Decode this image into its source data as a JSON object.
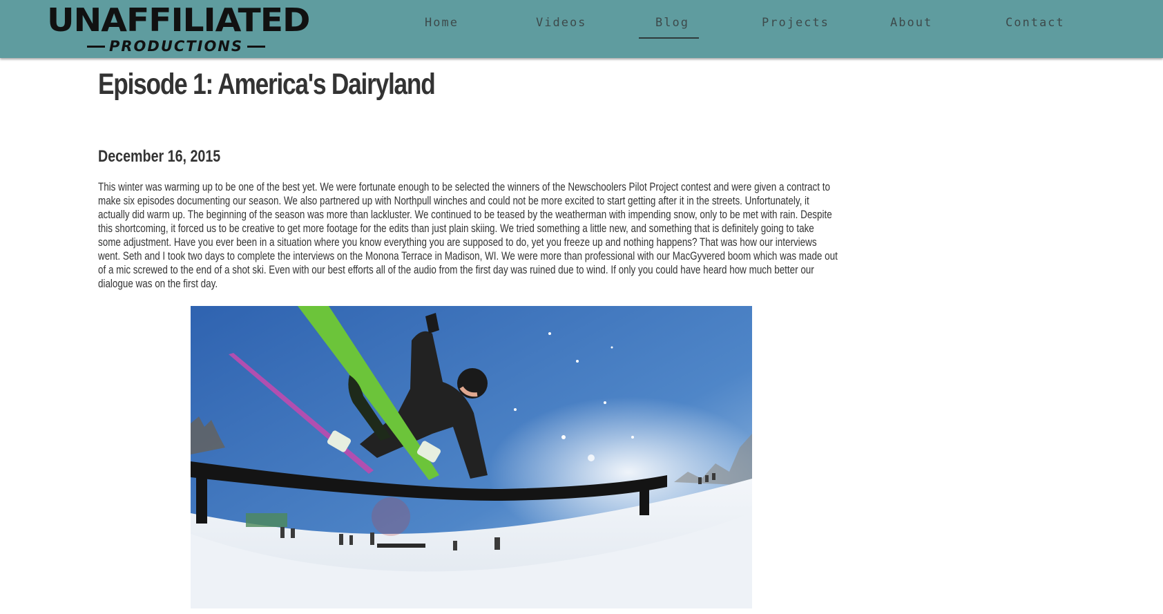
{
  "brand": {
    "logo_top": "UNAFFILIATED",
    "logo_bottom": "PRODUCTIONS"
  },
  "nav": {
    "items": [
      {
        "label": "Home",
        "active": false
      },
      {
        "label": "Videos",
        "active": false
      },
      {
        "label": "Blog",
        "active": true
      },
      {
        "label": "Projects",
        "active": false
      },
      {
        "label": "About",
        "active": false
      },
      {
        "label": "Contact",
        "active": false
      }
    ]
  },
  "post": {
    "title": "Episode 1: America's Dairyland",
    "date": "December 16, 2015",
    "body": "This winter was warming up to be one of the best yet. We were fortunate enough to be selected the winners of the Newschoolers Pilot Project contest and were given a contract to make six episodes documenting our season. We also partnered up with Northpull winches and could not be more excited to start getting after it in the streets. Unfortunately, it actually did warm up. The beginning of the season was more than lackluster. We continued to be teased by the weatherman with impending snow, only to be met with rain. Despite this shortcoming, it forced us to be creative to get more footage for the edits than just plain skiing. We tried something a little new, and something that is definitely going to take some adjustment. Have you ever been in a situation where you know everything you are supposed to do, yet you freeze up and nothing happens? That was how our interviews went. Seth and I took two days to complete the interviews on the Monona Terrace in Madison, WI. We were more than professional with our MacGyvered boom which was made out of a mic screwed to the end of a shot ski. Even with our best efforts all of the audio from the first day was ruined due to wind. If only you could have heard how much better our dialogue was on the first day."
  },
  "colors": {
    "header_bg": "#5f9c9f",
    "nav_text": "#3d4a4b",
    "heading_text": "#333333",
    "ski_top_sheet": "#6cc43a",
    "sky": "#3f72b8"
  }
}
